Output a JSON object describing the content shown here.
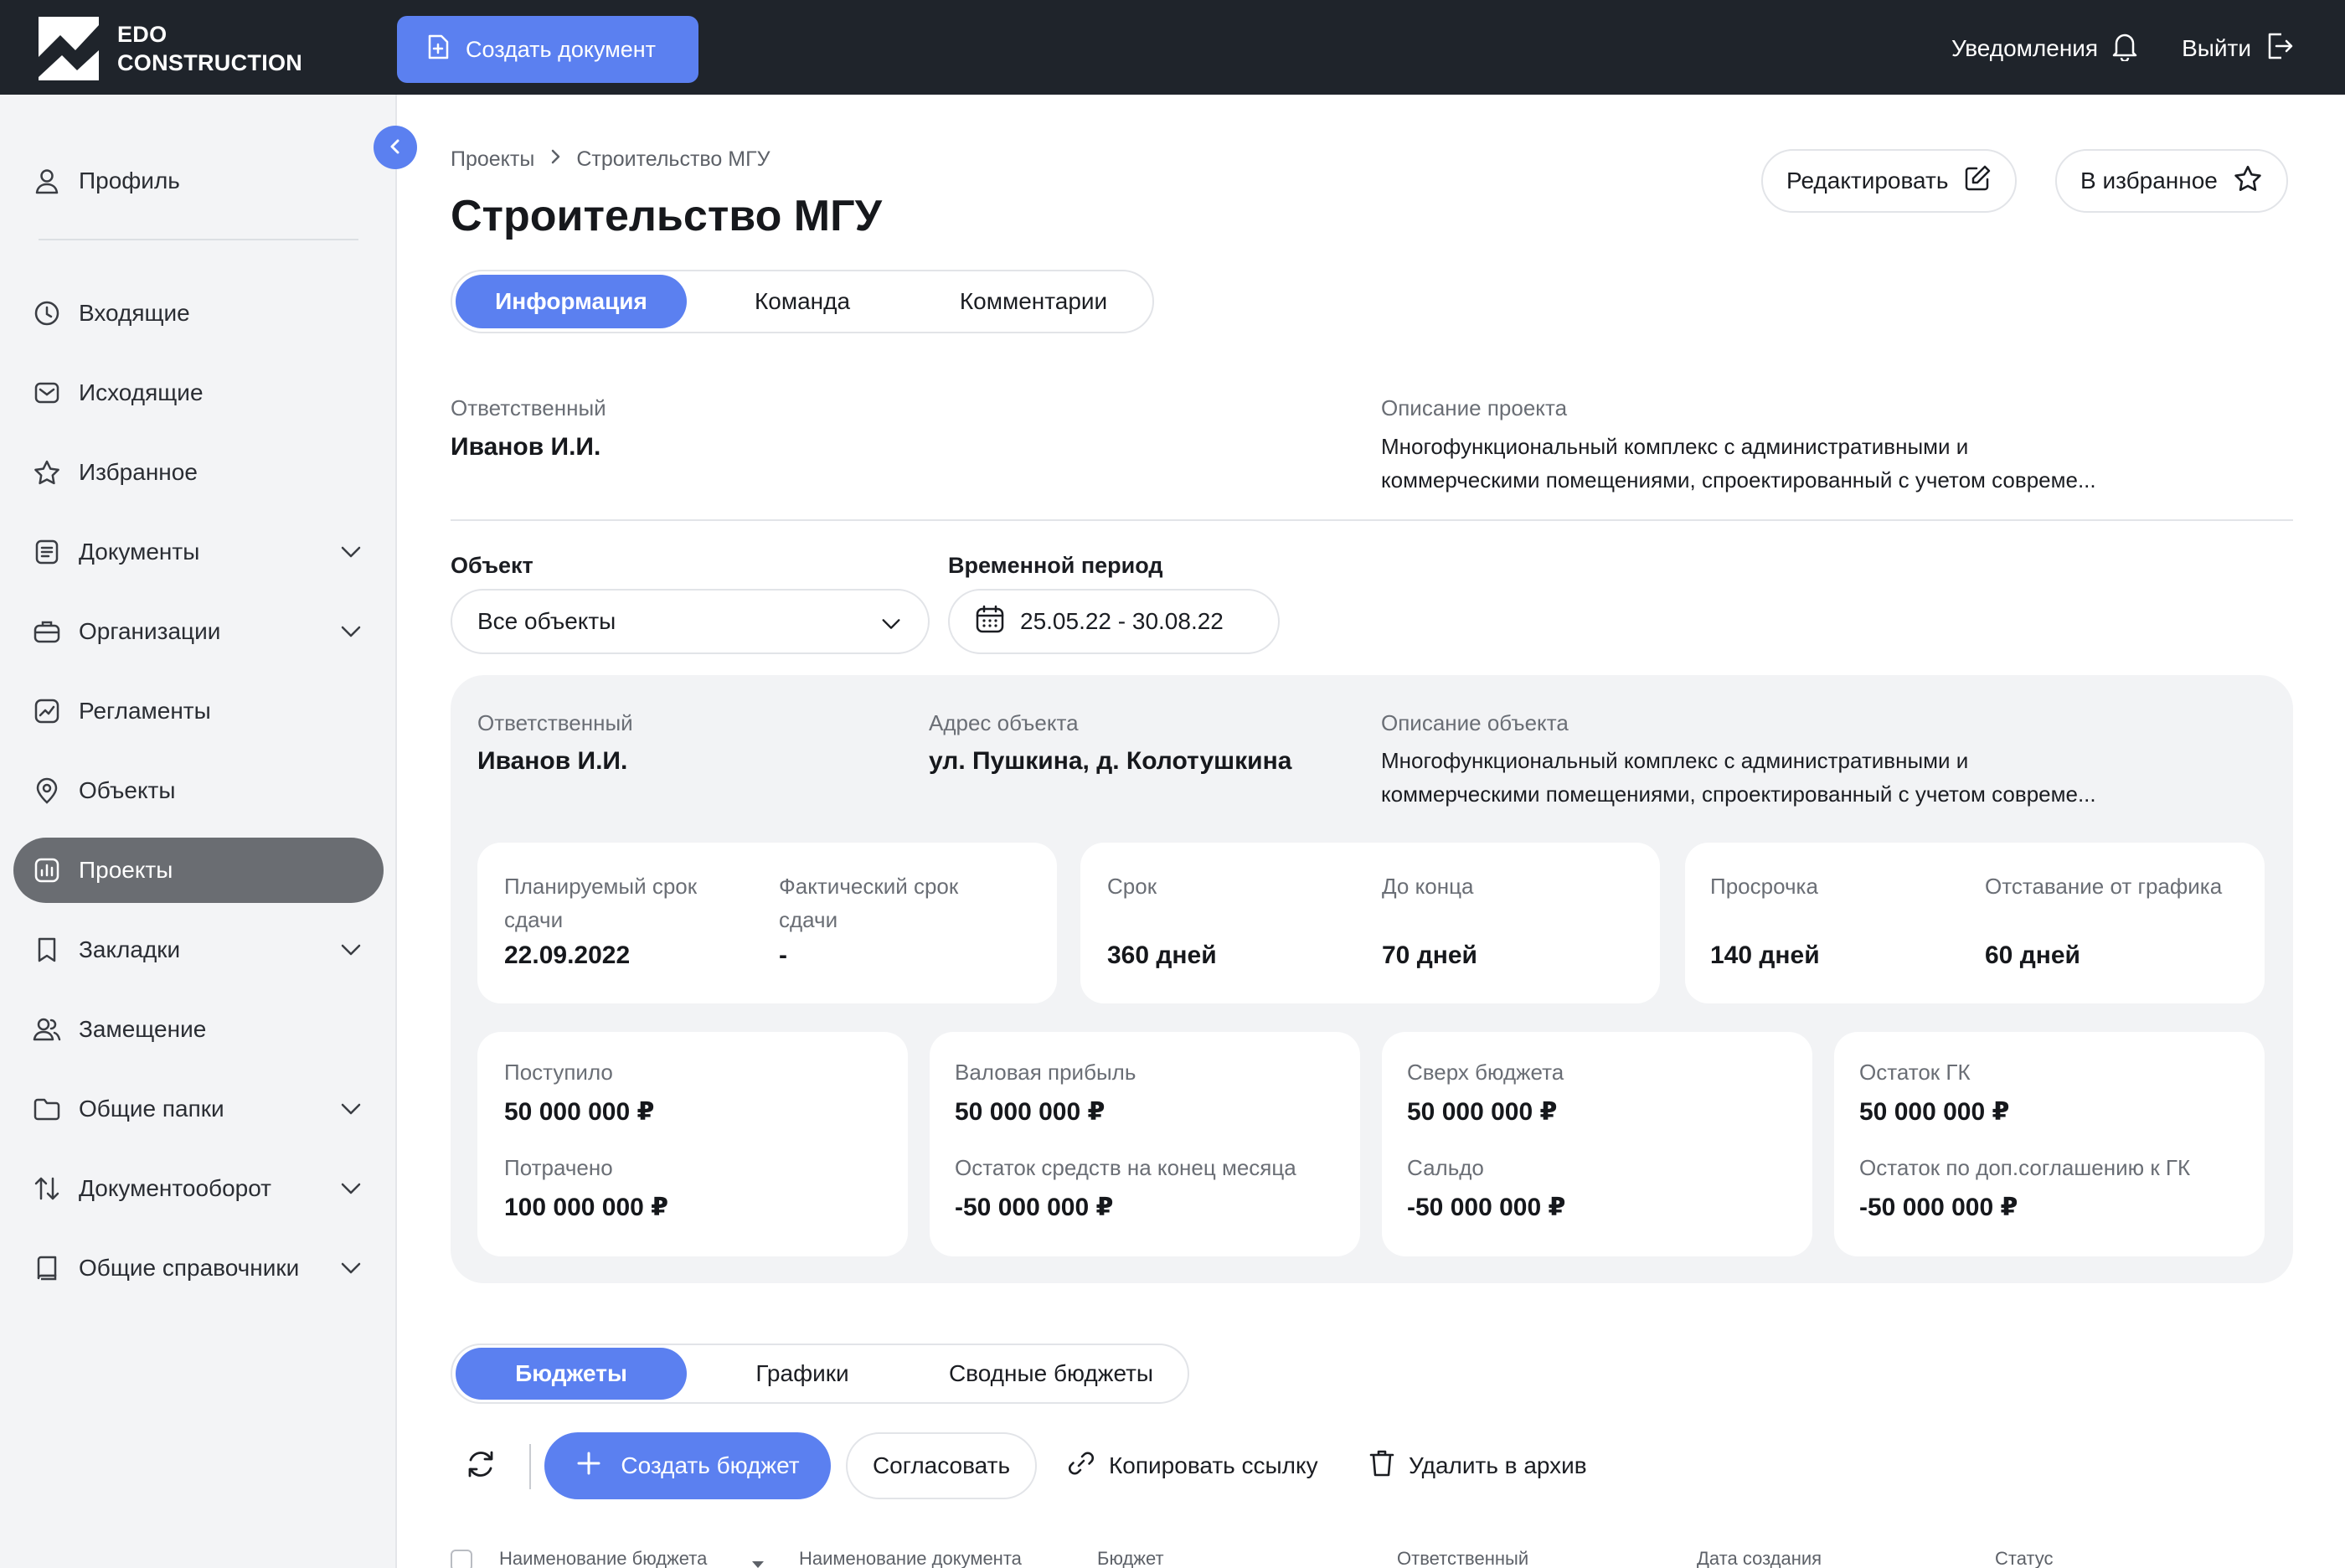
{
  "app": {
    "logo_line1": "EDO",
    "logo_line2": "CONSTRUCTION",
    "create_document": "Создать документ",
    "notifications": "Уведомления",
    "logout": "Выйти"
  },
  "colors": {
    "accent": "#5b80f0",
    "topbar": "#1f242b",
    "sidebar_active": "#6a6d72",
    "panel": "#f2f3f5"
  },
  "sidebar": {
    "profile": "Профиль",
    "items": [
      {
        "label": "Входящие",
        "icon": "clock-icon"
      },
      {
        "label": "Исходящие",
        "icon": "envelope-icon"
      },
      {
        "label": "Избранное",
        "icon": "star-icon"
      },
      {
        "label": "Документы",
        "icon": "document-icon"
      },
      {
        "label": "Организации",
        "icon": "briefcase-icon"
      },
      {
        "label": "Регламенты",
        "icon": "chart-icon"
      },
      {
        "label": "Объекты",
        "icon": "location-icon"
      },
      {
        "label": "Проекты",
        "icon": "bar-chart-icon"
      },
      {
        "label": "Закладки",
        "icon": "bookmark-icon"
      },
      {
        "label": "Замещение",
        "icon": "users-icon"
      },
      {
        "label": "Общие папки",
        "icon": "folder-icon"
      },
      {
        "label": "Документооборот",
        "icon": "transfer-icon"
      },
      {
        "label": "Общие справочники",
        "icon": "book-icon"
      }
    ]
  },
  "breadcrumb": {
    "root": "Проекты",
    "current": "Строительство МГУ"
  },
  "page": {
    "title": "Строительство МГУ",
    "edit": "Редактировать",
    "favorite": "В избранное"
  },
  "tabs": [
    "Информация",
    "Команда",
    "Комментарии"
  ],
  "info": {
    "responsible_label": "Ответственный",
    "responsible": "Иванов И.И.",
    "description_label": "Описание проекта",
    "description_line1": "Многофункциональный комплекс с административными и",
    "description_line2": "коммерческими помещениями, спроектированный с учетом совреме..."
  },
  "filters": {
    "object_label": "Объект",
    "object_value": "Все объекты",
    "period_label": "Временной период",
    "period_value": "25.05.22 - 30.08.22"
  },
  "object": {
    "responsible_label": "Ответственный",
    "responsible": "Иванов И.И.",
    "address_label": "Адрес объекта",
    "address": "ул. Пушкина, д. Колотушкина",
    "description_label": "Описание объекта",
    "description_line1": "Многофункциональный комплекс с административными и",
    "description_line2": "коммерческими помещениями, спроектированный с учетом совреме..."
  },
  "timing": {
    "planned_label_1": "Планируемый срок",
    "planned_label_2": "сдачи",
    "planned": "22.09.2022",
    "actual_label_1": "Фактический срок",
    "actual_label_2": "сдачи",
    "actual": "-",
    "term_label": "Срок",
    "term": "360 дней",
    "left_label": "До конца",
    "left": "70 дней",
    "overdue_label": "Просрочка",
    "overdue": "140 дней",
    "lag_label": "Отставание от графика",
    "lag": "60 дней"
  },
  "finance": {
    "received_label": "Поступило",
    "received": "50 000 000 ₽",
    "spent_label": "Потрачено",
    "spent": "100 000 000 ₽",
    "gross_label": "Валовая прибыль",
    "gross": "50 000 000 ₽",
    "month_end_label": "Остаток средств на конец месяца",
    "month_end": "-50 000 000 ₽",
    "over_label": "Сверх бюджета",
    "over": "50 000 000 ₽",
    "balance_label": "Сальдо",
    "balance": "-50 000 000 ₽",
    "gk_label": "Остаток ГК",
    "gk": "50 000 000 ₽",
    "gk_add_label": "Остаток по доп.соглашению к ГК",
    "gk_add": "-50 000 000 ₽"
  },
  "budget_tabs": [
    "Бюджеты",
    "Графики",
    "Сводные бюджеты"
  ],
  "toolbar": {
    "create_budget": "Создать бюджет",
    "approve": "Согласовать",
    "copy_link": "Копировать ссылку",
    "archive": "Удалить в архив"
  },
  "table": {
    "columns": [
      "Наименование бюджета",
      "Наименование документа",
      "Бюджет",
      "Ответственный",
      "Дата создания",
      "Статус"
    ]
  }
}
